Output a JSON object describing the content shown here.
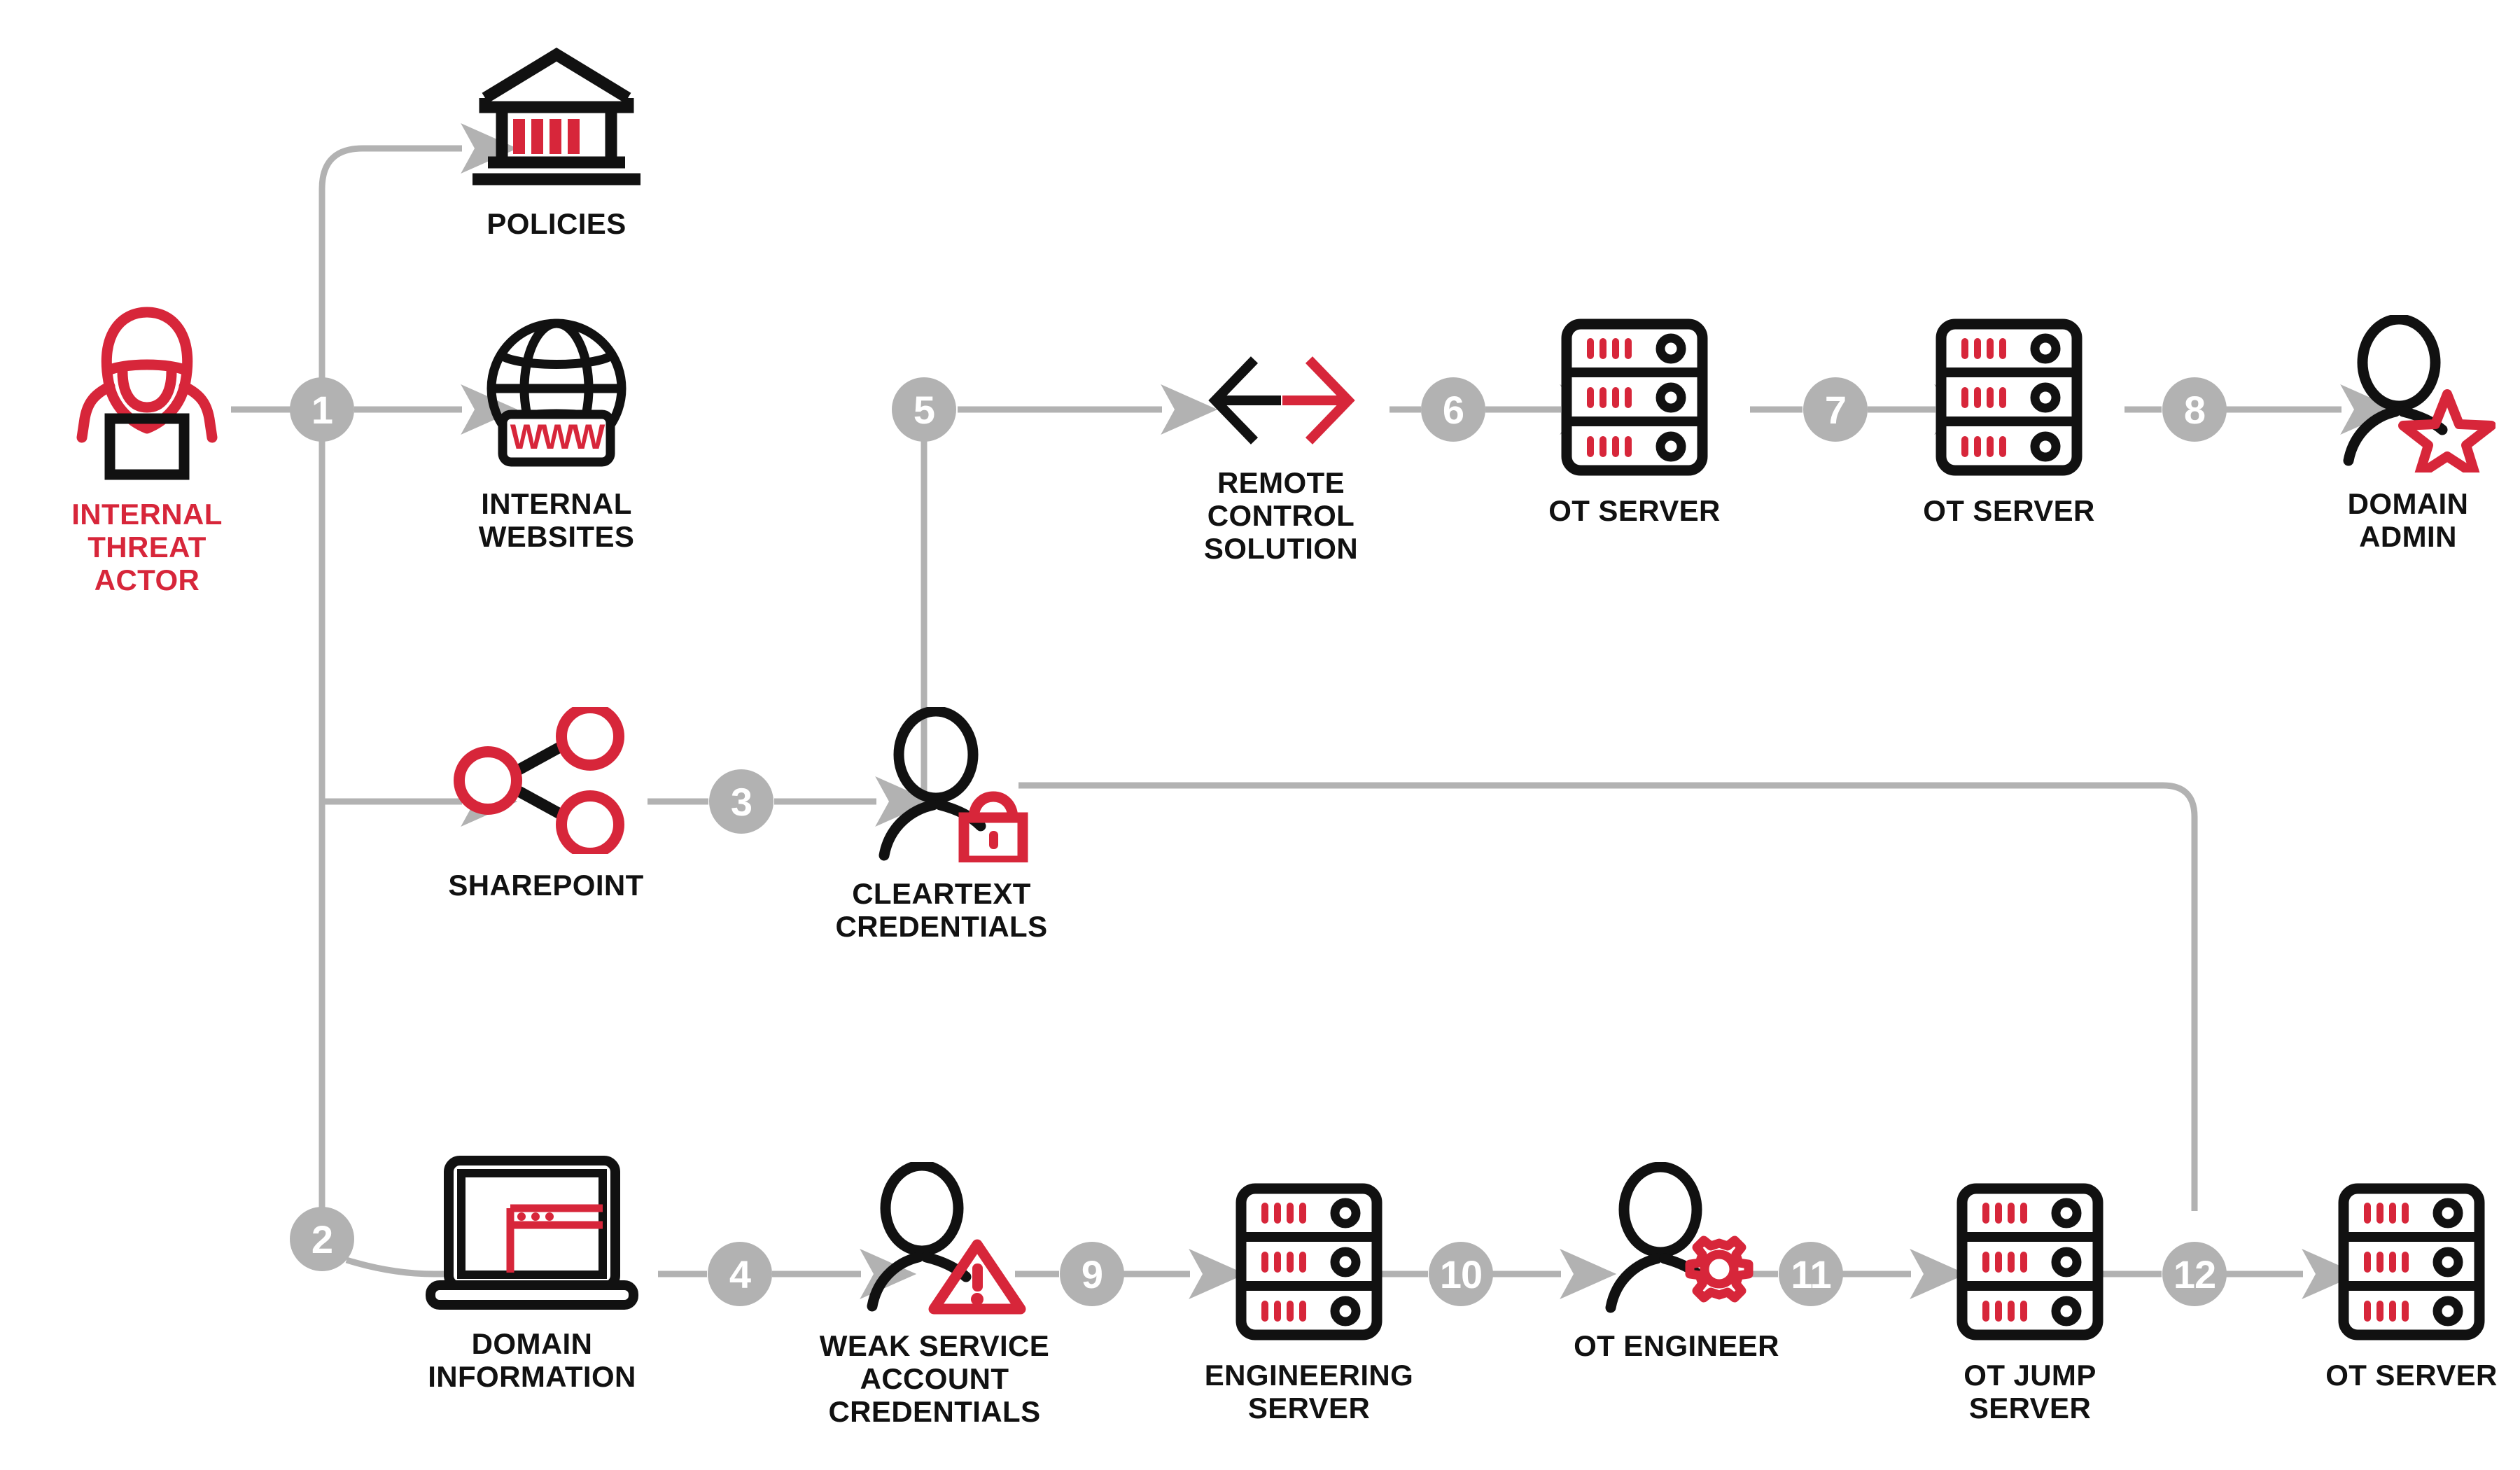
{
  "diagram": {
    "title": "Internal Threat Actor OT Attack Path",
    "colors": {
      "red": "#d7263a",
      "black": "#111111",
      "gray": "#b2b2b2",
      "white": "#ffffff"
    }
  },
  "nodes": [
    {
      "id": "internal-threat-actor",
      "label": "INTERNAL\nTHREAT\nACTOR",
      "icon": "hacker-icon",
      "label_color": "red"
    },
    {
      "id": "policies",
      "label": "POLICIES",
      "icon": "bank-building-icon",
      "label_color": "black"
    },
    {
      "id": "internal-websites",
      "label": "INTERNAL\nWEBSITES",
      "icon": "globe-www-icon",
      "label_color": "black"
    },
    {
      "id": "sharepoint",
      "label": "SHAREPOINT",
      "icon": "share-nodes-icon",
      "label_color": "black"
    },
    {
      "id": "cleartext-credentials",
      "label": "CLEARTEXT\nCREDENTIALS",
      "icon": "user-lock-icon",
      "label_color": "black"
    },
    {
      "id": "remote-control-solution",
      "label": "REMOTE CONTROL\nSOLUTION",
      "icon": "bidirectional-arrow-icon",
      "label_color": "black"
    },
    {
      "id": "ot-server-1",
      "label": "OT SERVER",
      "icon": "server-rack-icon",
      "label_color": "black"
    },
    {
      "id": "ot-server-2",
      "label": "OT SERVER",
      "icon": "server-rack-icon",
      "label_color": "black"
    },
    {
      "id": "domain-admin",
      "label": "DOMAIN\nADMIN",
      "icon": "user-star-icon",
      "label_color": "black"
    },
    {
      "id": "domain-information",
      "label": "DOMAIN\nINFORMATION",
      "icon": "laptop-browser-icon",
      "label_color": "black"
    },
    {
      "id": "weak-service-account-credentials",
      "label": "WEAK SERVICE\nACCOUNT\nCREDENTIALS",
      "icon": "user-warning-icon",
      "label_color": "black"
    },
    {
      "id": "engineering-server",
      "label": "ENGINEERING\nSERVER",
      "icon": "server-rack-icon",
      "label_color": "black"
    },
    {
      "id": "ot-engineer",
      "label": "OT ENGINEER",
      "icon": "user-gear-icon",
      "label_color": "black"
    },
    {
      "id": "ot-jump-server",
      "label": "OT JUMP\nSERVER",
      "icon": "server-rack-icon",
      "label_color": "black"
    },
    {
      "id": "ot-server-3",
      "label": "OT SERVER",
      "icon": "server-rack-icon",
      "label_color": "black"
    }
  ],
  "steps": [
    {
      "n": "1",
      "from": "internal-threat-actor",
      "to": "policies / internal-websites / sharepoint"
    },
    {
      "n": "2",
      "from": "internal-threat-actor",
      "to": "domain-information"
    },
    {
      "n": "3",
      "from": "sharepoint",
      "to": "cleartext-credentials"
    },
    {
      "n": "4",
      "from": "domain-information",
      "to": "weak-service-account-credentials"
    },
    {
      "n": "5",
      "from": "cleartext-credentials",
      "to": "remote-control-solution"
    },
    {
      "n": "6",
      "from": "remote-control-solution",
      "to": "ot-server-1"
    },
    {
      "n": "7",
      "from": "ot-server-1",
      "to": "ot-server-2"
    },
    {
      "n": "8",
      "from": "ot-server-2",
      "to": "domain-admin"
    },
    {
      "n": "9",
      "from": "weak-service-account-credentials",
      "to": "engineering-server"
    },
    {
      "n": "10",
      "from": "engineering-server",
      "to": "ot-engineer"
    },
    {
      "n": "11",
      "from": "ot-engineer",
      "to": "ot-jump-server"
    },
    {
      "n": "12",
      "from": "ot-jump-server",
      "to": "ot-server-3"
    }
  ]
}
